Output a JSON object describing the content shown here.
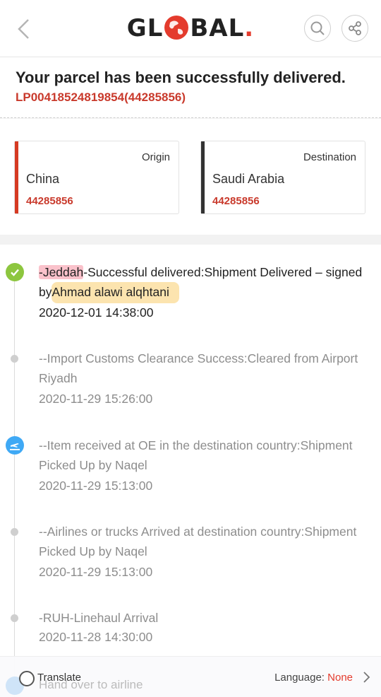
{
  "header": {
    "logo_pre": "GL",
    "logo_post": "BAL",
    "logo_dot": "."
  },
  "summary": {
    "title": "Your parcel has been successfully delivered.",
    "tracking": "LP00418524819854(44285856)"
  },
  "route": {
    "origin": {
      "label": "Origin",
      "country": "China",
      "number": "44285856"
    },
    "destination": {
      "label": "Destination",
      "country": "Saudi Arabia",
      "number": "44285856"
    }
  },
  "events": [
    {
      "city": "-Jeddah",
      "text_rest": "-Successful delivered:Shipment Delivered – signed by",
      "signer": "Ahmad alawi alqhtani",
      "time": "2020-12-01 14:38:00",
      "icon": "check-icon"
    },
    {
      "text": "--Import Customs Clearance Success:Cleared from Airport Riyadh",
      "time": "2020-11-29 15:26:00",
      "icon": "dot"
    },
    {
      "text": "--Item received at OE in the destination country:Shipment Picked Up by Naqel",
      "time": "2020-11-29 15:13:00",
      "icon": "plane-landing-icon"
    },
    {
      "text": "--Airlines or trucks Arrived at destination country:Shipment Picked Up by Naqel",
      "time": "2020-11-29 15:13:00",
      "icon": "dot"
    },
    {
      "text": "-RUH-Linehaul Arrival",
      "time": "2020-11-28 14:30:00",
      "icon": "dot"
    },
    {
      "text": "Hand over to airline",
      "icon": "plane-icon"
    }
  ],
  "bottom": {
    "translate": "Translate",
    "language_label": "Language:",
    "language_value": "None"
  },
  "colors": {
    "brand_red": "#e43b2d",
    "tracking_red": "#c93a2c",
    "success_green": "#8dc63f",
    "info_blue": "#3fa9f5",
    "dest_bar": "#333333"
  }
}
